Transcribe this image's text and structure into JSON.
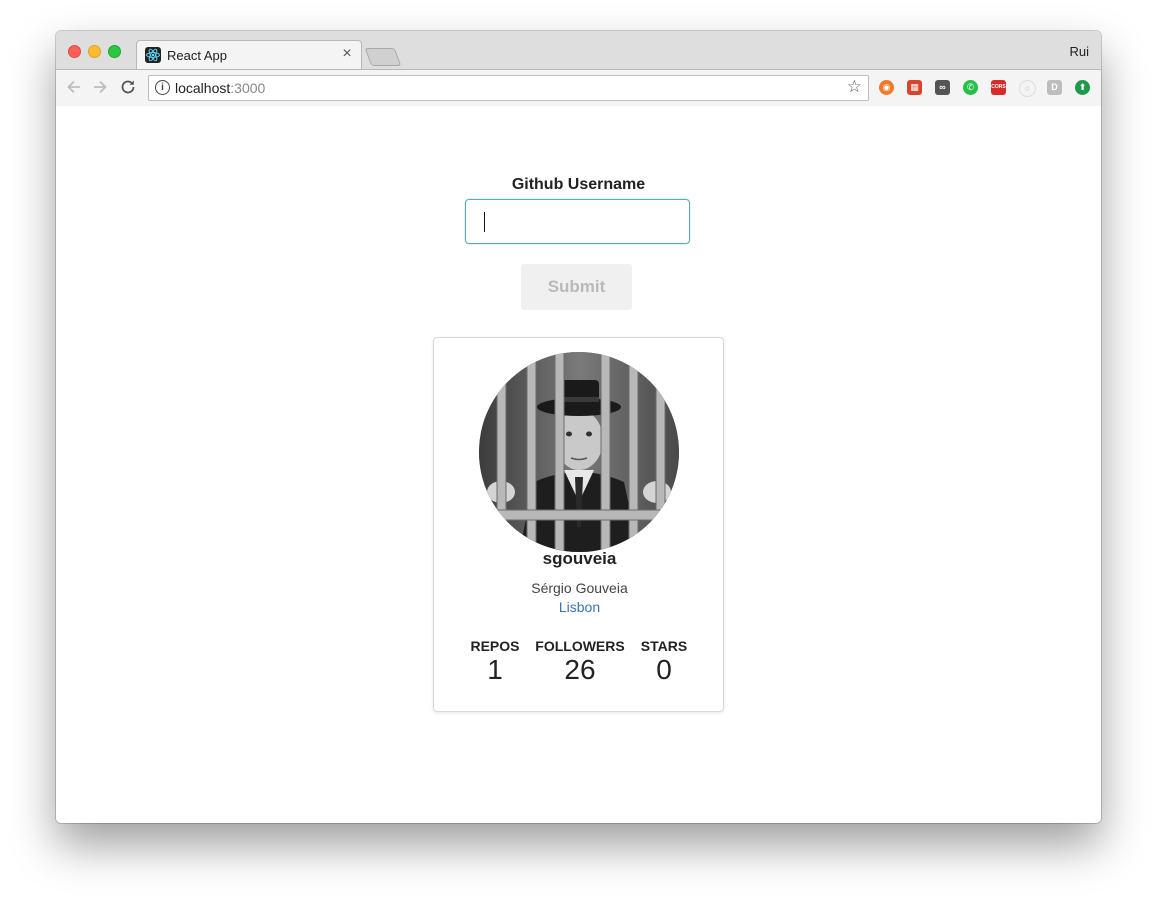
{
  "browser": {
    "tab_title": "React App",
    "tab_close": "×",
    "profile_name": "Rui",
    "url_host": "localhost",
    "url_port": ":3000",
    "icons": {
      "back": "arrow-left",
      "forward": "arrow-right",
      "reload": "reload",
      "info": "info",
      "bookmark": "star"
    },
    "extensions": [
      {
        "name": "ext-orange-icon",
        "color": "#f07b28",
        "glyph": "◉"
      },
      {
        "name": "ext-red-pattern-icon",
        "color": "#d9452b",
        "glyph": "▦"
      },
      {
        "name": "ext-mask-icon",
        "color": "#555555",
        "glyph": "∞"
      },
      {
        "name": "ext-whatsapp-icon",
        "color": "#25c04a",
        "glyph": "✆"
      },
      {
        "name": "ext-cors-icon",
        "color": "#d72a2a",
        "glyph": "CORS"
      },
      {
        "name": "ext-gray-circle-icon",
        "color": "#e0e0e0",
        "glyph": "○"
      },
      {
        "name": "ext-d-icon",
        "color": "#bdbdbd",
        "glyph": "D"
      },
      {
        "name": "ext-green-arrow-icon",
        "color": "#1e9a4a",
        "glyph": "⬆"
      }
    ]
  },
  "form": {
    "label": "Github Username",
    "input_value": "",
    "submit_label": "Submit"
  },
  "profile": {
    "username": "sgouveia",
    "full_name": "Sérgio Gouveia",
    "location": "Lisbon",
    "stats": [
      {
        "label": "REPOS",
        "value": "1"
      },
      {
        "label": "FOLLOWERS",
        "value": "26"
      },
      {
        "label": "STARS",
        "value": "0"
      }
    ]
  },
  "colors": {
    "accent_input_border": "#5fa8b8",
    "link": "#3a74b0",
    "submit_bg": "#f0f0f0",
    "submit_text": "#b9b9b9"
  }
}
